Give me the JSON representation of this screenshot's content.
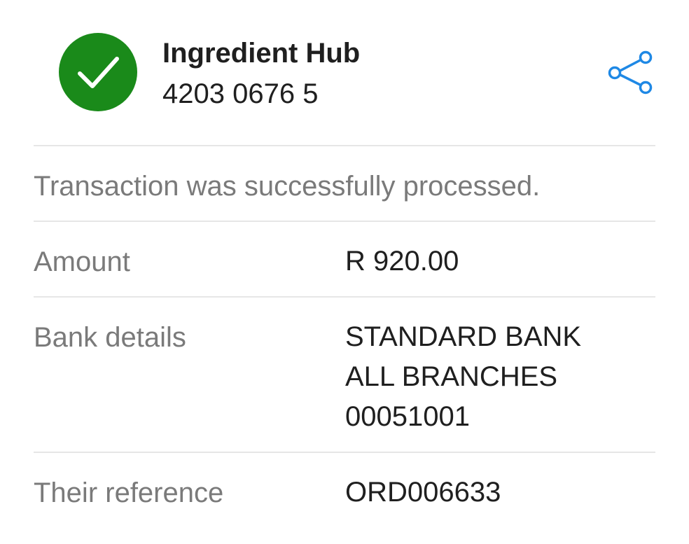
{
  "recipient": {
    "name": "Ingredient Hub",
    "account_number": "4203 0676 5"
  },
  "status": {
    "icon": "checkmark-icon",
    "color": "#1a8a1a"
  },
  "share": {
    "icon": "share-icon",
    "color": "#1e88e5"
  },
  "message": "Transaction was successfully processed.",
  "details": {
    "amount": {
      "label": "Amount",
      "value": "R 920.00"
    },
    "bank": {
      "label": "Bank details",
      "lines": [
        "STANDARD BANK",
        "ALL BRANCHES",
        "00051001"
      ]
    },
    "reference": {
      "label": "Their reference",
      "value": "ORD006633"
    }
  }
}
